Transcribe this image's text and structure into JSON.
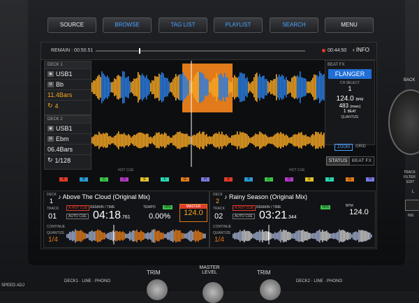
{
  "top_buttons": [
    "SOURCE",
    "BROWSE",
    "TAG LIST",
    "PLAYLIST",
    "SEARCH",
    "MENU"
  ],
  "header": {
    "remain": "REMAIN : 00:50.51",
    "time": "00:44:50",
    "info": "INFO"
  },
  "deck1": {
    "title": "DECK 1",
    "source": "USB1",
    "key": "Bb",
    "bars": "11.4Bars",
    "quantize": "4"
  },
  "deck2": {
    "title": "DECK 2",
    "source": "USB1",
    "key": "Ebm",
    "bars": "06.4Bars",
    "quantize": "1/128"
  },
  "fx": {
    "title": "BEAT FX",
    "effect": "FLANGER",
    "ch_select": "CH SELECT",
    "ch": "1",
    "bpm": "124.0",
    "bpm_unit": "BPM",
    "ms": "483",
    "ms_unit": "(msec)",
    "beat": "1",
    "beat_unit": "BEAT",
    "quantize": "QUANTIZE"
  },
  "zoom": "ZOOM",
  "grid": "GRID",
  "status": "STATUS",
  "beatfx": "BEAT FX",
  "hotcue": "HOT CUE",
  "pads": [
    "A",
    "B",
    "C",
    "D",
    "E",
    "F",
    "G",
    "H"
  ],
  "colors": {
    "orange": "#f5a623",
    "blue": "#2a7de1",
    "accent": "#4aa3ff",
    "red": "#e23a2a",
    "green": "#3cc24a"
  },
  "bottom1": {
    "deck": "DECK",
    "num": "1",
    "title": "Above The Cloud (Original Mix)",
    "track": "TRACK",
    "track_num": "01",
    "hotcue_lbl": "A.HOT CUE",
    "remain": "REMAIN",
    "time_lbl": "TIME",
    "autocue": "AUTO CUE",
    "time": "04:18",
    "ms": ".761",
    "tempo_lbl": "TEMPO",
    "tempo_badge": "±6%",
    "tempo": "0.00%",
    "master": "MASTER",
    "bpm": "124.0",
    "continue": "CONTINUE",
    "quantize": "QUANTIZE",
    "frac": "1/4"
  },
  "bottom2": {
    "deck": "DECK",
    "num": "2",
    "title": "Rainy Season (Original Mix)",
    "track": "TRACK",
    "track_num": "02",
    "hotcue_lbl": "A.HOT CUE",
    "remain": "REMAIN",
    "time_lbl": "TIME",
    "autocue": "AUTO CUE",
    "time": "03:21",
    "ms": ".344",
    "bpm_lbl": "BPM",
    "tempo_badge": "±6%",
    "bpm": "124.0",
    "continue": "CONTINUE",
    "quantize": "QUANTIZE",
    "frac": "1/4"
  },
  "side": {
    "back": "BACK",
    "track": "TRACK",
    "filter": "FILTER",
    "edit": "EDIT",
    "ins": "INS",
    "l": "L"
  },
  "mixer": {
    "trim": "TRIM",
    "master_level": "MASTER LEVEL",
    "deck1": "DECK1",
    "line": "LINE",
    "phono": "PHONO",
    "deck2": "DECK2",
    "speed_adj": "SPEED ADJ"
  }
}
